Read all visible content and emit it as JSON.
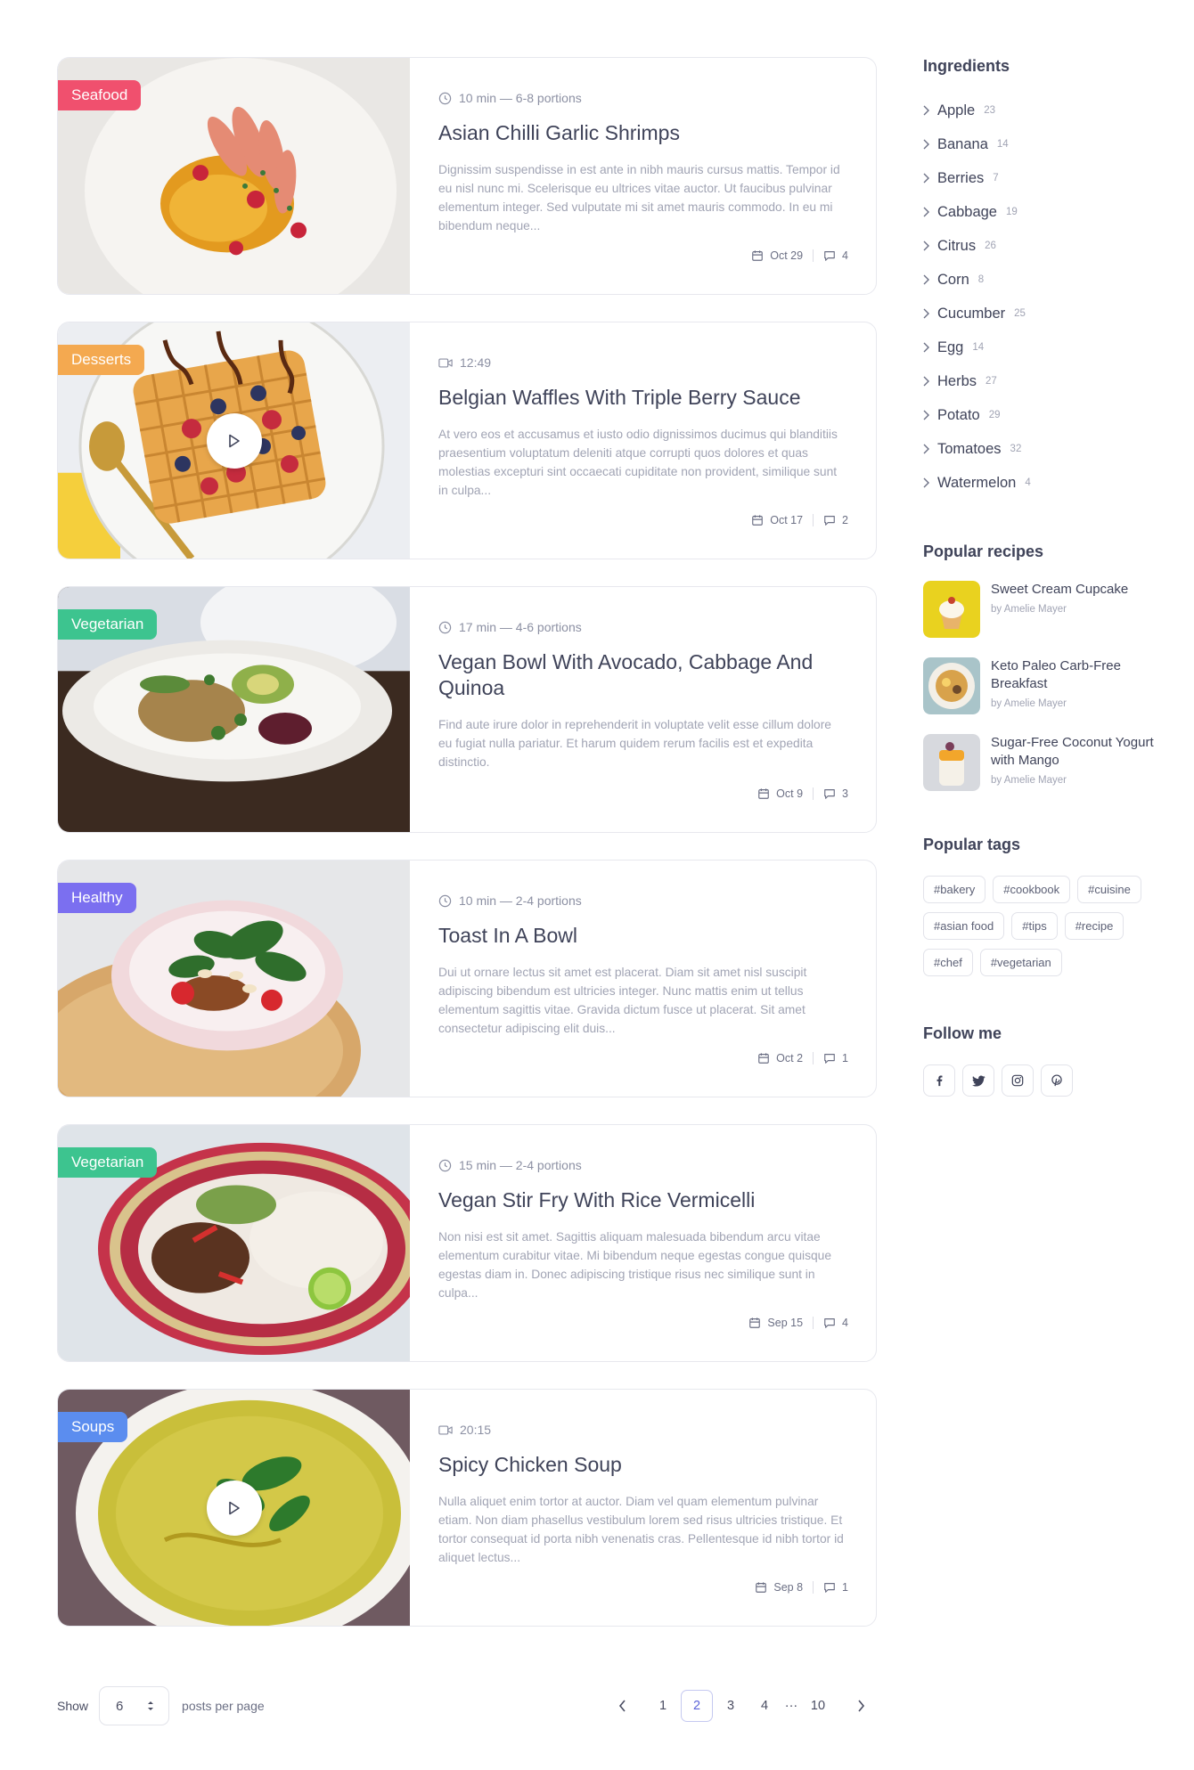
{
  "posts": [
    {
      "category": "Seafood",
      "category_color": "#f0506e",
      "meta_icon": "clock-icon",
      "meta": "10 min — 6-8 portions",
      "title": "Asian Chilli Garlic Shrimps",
      "excerpt": "Dignissim suspendisse in est ante in nibh mauris cursus mattis. Tempor id eu nisl nunc mi. Scelerisque eu ultrices vitae auctor. Ut faucibus pulvinar elementum integer. Sed vulputate mi sit amet mauris commodo. In eu mi bibendum neque...",
      "date": "Oct 29",
      "comments": "4",
      "has_video": false
    },
    {
      "category": "Desserts",
      "category_color": "#f4a950",
      "meta_icon": "video-icon",
      "meta": "12:49",
      "title": "Belgian Waffles With Triple Berry Sauce",
      "excerpt": "At vero eos et accusamus et iusto odio dignissimos ducimus qui blanditiis praesentium voluptatum deleniti atque corrupti quos dolores et quas molestias excepturi sint occaecati cupiditate non provident, similique sunt in culpa...",
      "date": "Oct 17",
      "comments": "2",
      "has_video": true
    },
    {
      "category": "Vegetarian",
      "category_color": "#3dc48f",
      "meta_icon": "clock-icon",
      "meta": "17 min — 4-6 portions",
      "title": "Vegan Bowl With Avocado, Cabbage And Quinoa",
      "excerpt": "Find aute irure dolor in reprehenderit in voluptate velit esse cillum dolore eu fugiat nulla pariatur. Et harum quidem rerum facilis est et expedita distinctio.",
      "date": "Oct 9",
      "comments": "3",
      "has_video": false
    },
    {
      "category": "Healthy",
      "category_color": "#7b6ff0",
      "meta_icon": "clock-icon",
      "meta": "10 min — 2-4 portions",
      "title": "Toast In A Bowl",
      "excerpt": "Dui ut ornare lectus sit amet est placerat. Diam sit amet nisl suscipit adipiscing bibendum est ultricies integer. Nunc mattis enim ut tellus elementum sagittis vitae. Gravida dictum fusce ut placerat. Sit amet consectetur adipiscing elit duis...",
      "date": "Oct 2",
      "comments": "1",
      "has_video": false
    },
    {
      "category": "Vegetarian",
      "category_color": "#3dc48f",
      "meta_icon": "clock-icon",
      "meta": "15 min — 2-4 portions",
      "title": "Vegan Stir Fry With Rice Vermicelli",
      "excerpt": "Non nisi est sit amet. Sagittis aliquam malesuada bibendum arcu vitae elementum curabitur vitae. Mi bibendum neque egestas congue quisque egestas diam in. Donec adipiscing tristique risus nec similique sunt in culpa...",
      "date": "Sep 15",
      "comments": "4",
      "has_video": false
    },
    {
      "category": "Soups",
      "category_color": "#5b8def",
      "meta_icon": "video-icon",
      "meta": "20:15",
      "title": "Spicy Chicken Soup",
      "excerpt": "Nulla aliquet enim tortor at auctor. Diam vel quam elementum pulvinar etiam. Non diam phasellus vestibulum lorem sed risus ultricies tristique. Et tortor consequat id porta nibh venenatis cras. Pellentesque id nibh tortor id aliquet lectus...",
      "date": "Sep 8",
      "comments": "1",
      "has_video": true
    }
  ],
  "pagination": {
    "show_label": "Show",
    "per_page": "6",
    "per_page_label": "posts per page",
    "pages": [
      "1",
      "2",
      "3",
      "4",
      "10"
    ],
    "ellipsis": "···",
    "current": "2"
  },
  "sidebar": {
    "ingredients_title": "Ingredients",
    "ingredients": [
      {
        "name": "Apple",
        "count": "23"
      },
      {
        "name": "Banana",
        "count": "14"
      },
      {
        "name": "Berries",
        "count": "7"
      },
      {
        "name": "Cabbage",
        "count": "19"
      },
      {
        "name": "Citrus",
        "count": "26"
      },
      {
        "name": "Corn",
        "count": "8"
      },
      {
        "name": "Cucumber",
        "count": "25"
      },
      {
        "name": "Egg",
        "count": "14"
      },
      {
        "name": "Herbs",
        "count": "27"
      },
      {
        "name": "Potato",
        "count": "29"
      },
      {
        "name": "Tomatoes",
        "count": "32"
      },
      {
        "name": "Watermelon",
        "count": "4"
      }
    ],
    "popular_title": "Popular recipes",
    "popular": [
      {
        "name": "Sweet Cream Cupcake",
        "author": "by Amelie Mayer"
      },
      {
        "name": "Keto Paleo Carb-Free Breakfast",
        "author": "by Amelie Mayer"
      },
      {
        "name": "Sugar-Free Coconut Yogurt with Mango",
        "author": "by Amelie Mayer"
      }
    ],
    "tags_title": "Popular tags",
    "tags": [
      "#bakery",
      "#cookbook",
      "#cuisine",
      "#asian food",
      "#tips",
      "#recipe",
      "#chef",
      "#vegetarian"
    ],
    "follow_title": "Follow me",
    "social": [
      "facebook-icon",
      "twitter-icon",
      "instagram-icon",
      "pinterest-icon"
    ]
  }
}
